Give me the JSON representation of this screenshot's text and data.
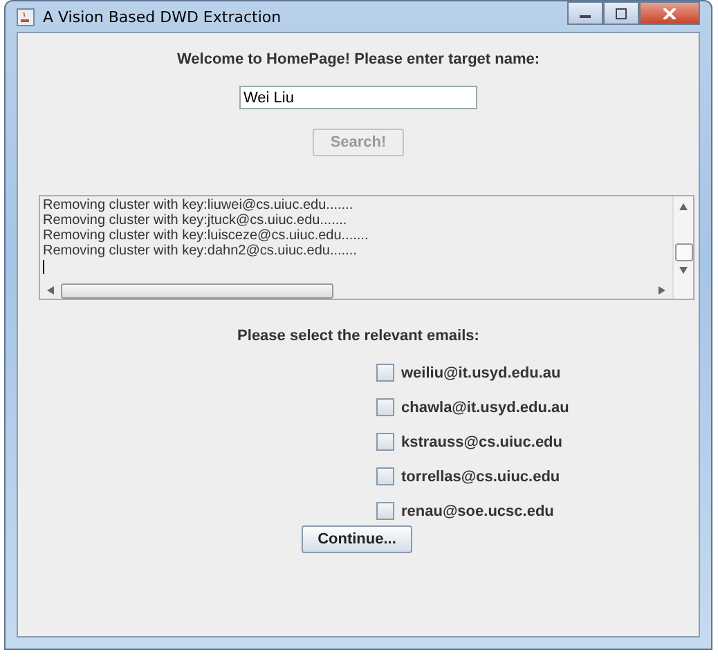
{
  "window": {
    "title": "A Vision Based DWD Extraction"
  },
  "prompt": "Welcome to HomePage! Please enter target name:",
  "name_field": {
    "value": "Wei Liu"
  },
  "search_button": {
    "label": "Search!",
    "disabled": true
  },
  "log": {
    "lines": [
      "Removing cluster with key:liuwei@cs.uiuc.edu.......",
      "Removing cluster with key:jtuck@cs.uiuc.edu.......",
      "Removing cluster with key:luisceze@cs.uiuc.edu.......",
      "Removing cluster with key:dahn2@cs.uiuc.edu......."
    ]
  },
  "select_label": "Please select the relevant emails:",
  "emails": [
    {
      "label": "weiliu@it.usyd.edu.au",
      "checked": false
    },
    {
      "label": "chawla@it.usyd.edu.au",
      "checked": false
    },
    {
      "label": "kstrauss@cs.uiuc.edu",
      "checked": false
    },
    {
      "label": "torrellas@cs.uiuc.edu",
      "checked": false
    },
    {
      "label": "renau@soe.ucsc.edu",
      "checked": false
    }
  ],
  "continue_button": {
    "label": "Continue..."
  }
}
